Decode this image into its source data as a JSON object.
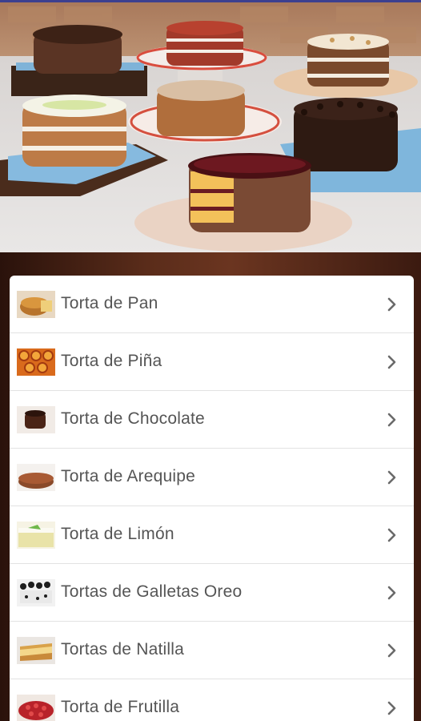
{
  "hero": {
    "image_name": "cakes-banner-image"
  },
  "menu": {
    "items": [
      {
        "label": "Torta de Pan",
        "thumb": "torta-de-pan-thumbnail"
      },
      {
        "label": "Torta de Piña",
        "thumb": "torta-de-pina-thumbnail"
      },
      {
        "label": "Torta de Chocolate",
        "thumb": "torta-de-chocolate-thumbnail"
      },
      {
        "label": "Torta de Arequipe",
        "thumb": "torta-de-arequipe-thumbnail"
      },
      {
        "label": "Torta de Limón",
        "thumb": "torta-de-limon-thumbnail"
      },
      {
        "label": "Tortas de Galletas Oreo",
        "thumb": "tortas-de-galletas-oreo-thumbnail"
      },
      {
        "label": "Tortas de Natilla",
        "thumb": "tortas-de-natilla-thumbnail"
      },
      {
        "label": "Torta de Frutilla",
        "thumb": "torta-de-frutilla-thumbnail"
      }
    ],
    "chevron_icon": "chevron-right-icon"
  },
  "colors": {
    "label_text": "#555555",
    "divider": "#e2e2e2",
    "list_background": "#ffffff",
    "status_line": "#3c3f8f"
  }
}
